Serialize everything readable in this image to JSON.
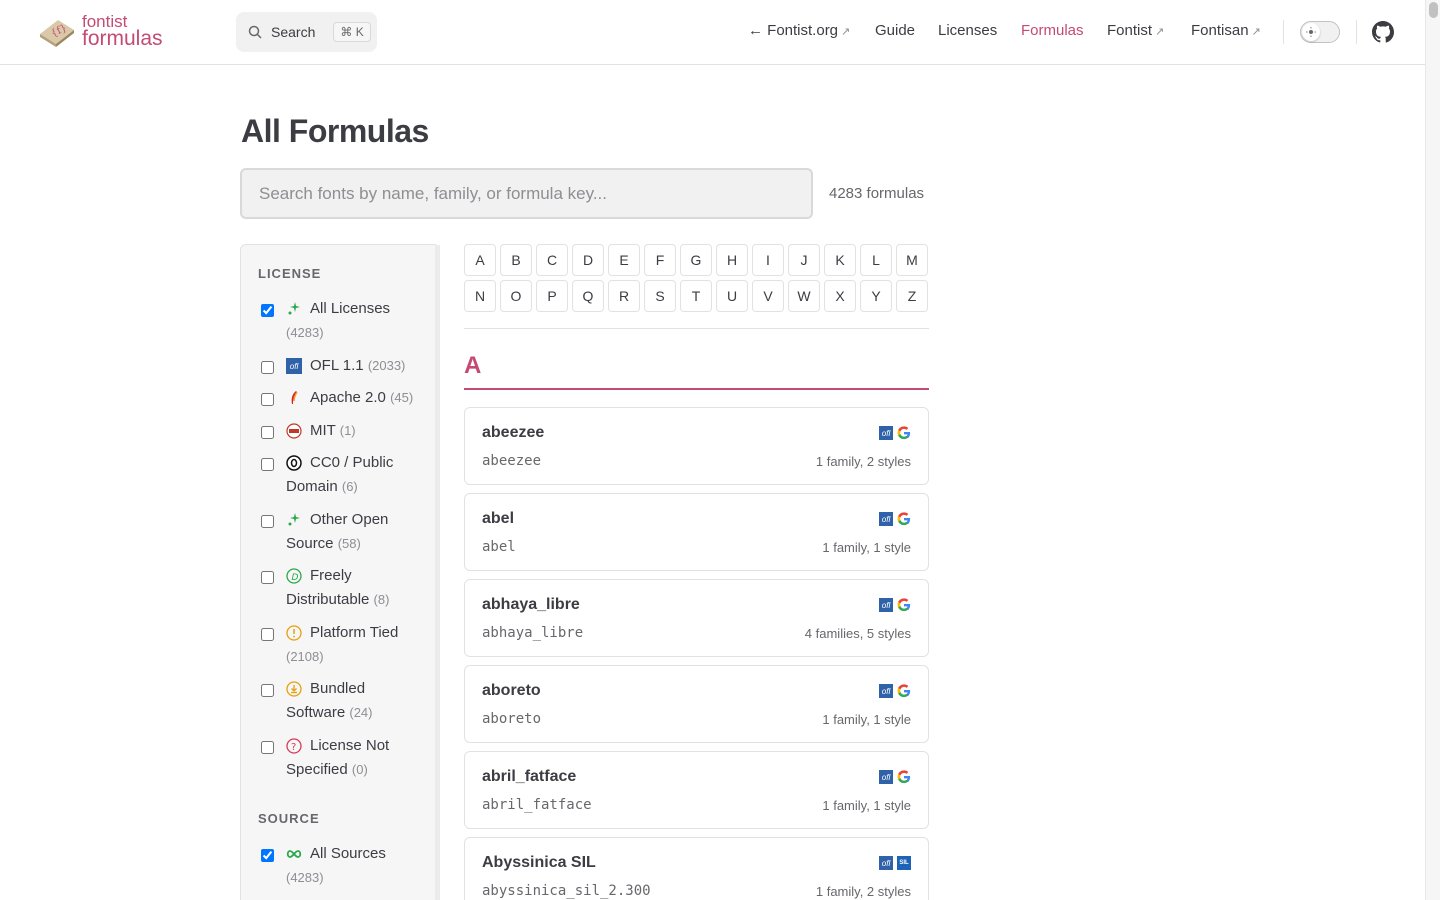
{
  "header": {
    "logo_line1": "fontist",
    "logo_line2": "formulas",
    "search_label": "Search",
    "search_kbd": "⌘ K",
    "nav": [
      {
        "label": "← Fontist.org",
        "external": true
      },
      {
        "label": "Guide",
        "external": false
      },
      {
        "label": "Licenses",
        "external": false
      },
      {
        "label": "Formulas",
        "external": false,
        "active": true
      },
      {
        "label": "Fontist",
        "external": true
      },
      {
        "label": "Fontisan",
        "external": true
      }
    ],
    "ext_glyph": "↗"
  },
  "main": {
    "title": "All Formulas",
    "search_placeholder": "Search fonts by name, family, or formula key...",
    "count": "4283 formulas"
  },
  "sidebar": {
    "license_title": "LICENSE",
    "licenses": [
      {
        "label": "All Licenses",
        "count": "(4283)",
        "checked": true,
        "icon": "sparkle-icon"
      },
      {
        "label": "OFL 1.1",
        "count": "(2033)",
        "checked": false,
        "icon": "ofl-icon"
      },
      {
        "label": "Apache 2.0",
        "count": "(45)",
        "checked": false,
        "icon": "apache-feather-icon"
      },
      {
        "label": "MIT",
        "count": "(1)",
        "checked": false,
        "icon": "mit-icon"
      },
      {
        "label": "CC0 / Public Domain",
        "count": "(6)",
        "checked": false,
        "icon": "cc0-icon"
      },
      {
        "label": "Other Open Source",
        "count": "(58)",
        "checked": false,
        "icon": "sparkle-icon"
      },
      {
        "label": "Freely Distributable",
        "count": "(8)",
        "checked": false,
        "icon": "freely-icon"
      },
      {
        "label": "Platform Tied",
        "count": "(2108)",
        "checked": false,
        "icon": "warning-icon"
      },
      {
        "label": "Bundled Software",
        "count": "(24)",
        "checked": false,
        "icon": "download-icon"
      },
      {
        "label": "License Not Specified",
        "count": "(0)",
        "checked": false,
        "icon": "question-icon"
      }
    ],
    "source_title": "SOURCE",
    "sources": [
      {
        "label": "All Sources",
        "count": "(4283)",
        "checked": true,
        "icon": "infinity-icon"
      }
    ]
  },
  "letters_row1": [
    "A",
    "B",
    "C",
    "D",
    "E",
    "F",
    "G",
    "H",
    "I",
    "J",
    "K",
    "L",
    "M"
  ],
  "letters_row2": [
    "N",
    "O",
    "P",
    "Q",
    "R",
    "S",
    "T",
    "U",
    "V",
    "W",
    "X",
    "Y",
    "Z"
  ],
  "section_letter": "A",
  "formulas": [
    {
      "name": "abeezee",
      "key": "abeezee",
      "meta": "1 family, 2 styles",
      "badges": [
        "ofl",
        "google"
      ]
    },
    {
      "name": "abel",
      "key": "abel",
      "meta": "1 family, 1 style",
      "badges": [
        "ofl",
        "google"
      ]
    },
    {
      "name": "abhaya_libre",
      "key": "abhaya_libre",
      "meta": "4 families, 5 styles",
      "badges": [
        "ofl",
        "google"
      ]
    },
    {
      "name": "aboreto",
      "key": "aboreto",
      "meta": "1 family, 1 style",
      "badges": [
        "ofl",
        "google"
      ]
    },
    {
      "name": "abril_fatface",
      "key": "abril_fatface",
      "meta": "1 family, 1 style",
      "badges": [
        "ofl",
        "google"
      ]
    },
    {
      "name": "Abyssinica SIL",
      "key": "abyssinica_sil_2.300",
      "meta": "1 family, 2 styles",
      "badges": [
        "ofl",
        "sil"
      ]
    }
  ],
  "colors": {
    "accent": "#c44b73"
  }
}
